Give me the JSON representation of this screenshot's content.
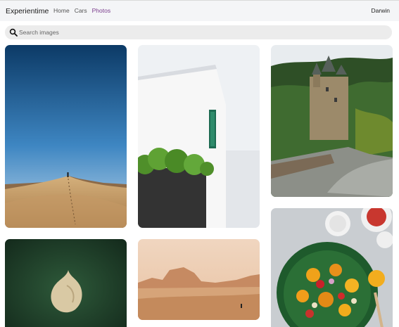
{
  "navbar": {
    "brand": "Experientime",
    "links": [
      {
        "label": "Home",
        "active": false
      },
      {
        "label": "Cars",
        "active": false
      },
      {
        "label": "Photos",
        "active": true
      }
    ],
    "user": "Darwin"
  },
  "search": {
    "placeholder": "Search images",
    "icon": "search-icon"
  },
  "colors": {
    "navbar_bg": "#f4f5f7",
    "active_link": "#7a3c8c",
    "search_bg": "#ececec"
  },
  "gallery": {
    "images": [
      {
        "name": "desert-dune-photo"
      },
      {
        "name": "white-building-photo"
      },
      {
        "name": "castle-photo"
      },
      {
        "name": "forest-aerial-photo"
      },
      {
        "name": "desert-landscape-photo"
      },
      {
        "name": "salad-food-photo"
      }
    ]
  }
}
